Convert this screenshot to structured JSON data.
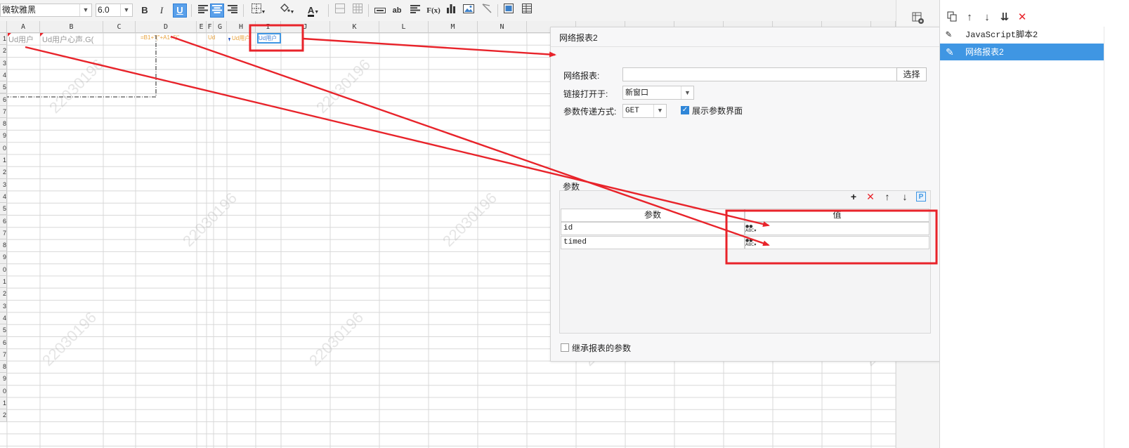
{
  "toolbar": {
    "font_name": "微软雅黑",
    "font_size": "6.0",
    "icons": [
      "bold-icon",
      "italic-icon",
      "underline-icon",
      "align-left-icon",
      "align-center-icon",
      "align-right-icon",
      "border-icon",
      "fill-color-icon",
      "font-color-icon",
      "merge-icon",
      "split-icon",
      "text-field-icon",
      "ab-icon",
      "paragraph-icon",
      "formula-icon",
      "bar-chart-icon",
      "image-icon",
      "slash-icon",
      "sheet-icon",
      "grid-icon"
    ],
    "bold": "B",
    "italic": "I",
    "underline": "U",
    "formula": "F(x)",
    "ab": "ab",
    "font_color_letter": "A"
  },
  "grid": {
    "columns": [
      "A",
      "B",
      "C",
      "D",
      "E",
      "F",
      "G",
      "H",
      "I",
      "J",
      "K",
      "L",
      "M",
      "N"
    ],
    "row_numbers": [
      "1",
      "2",
      "3",
      "4",
      "5",
      "6",
      "7",
      "8",
      "9",
      "0",
      "1",
      "2",
      "3",
      "4",
      "5",
      "6",
      "7",
      "8",
      "9",
      "0",
      "1",
      "2",
      "3",
      "4",
      "5",
      "6",
      "7",
      "8",
      "9",
      "0",
      "1",
      "2"
    ],
    "cells": {
      "a1": "Ud用户",
      "b1": "Ud用户心声.G(",
      "d1": "=B1+\"(\"+A1+\")\"",
      "h1": "Ud",
      "h1b": "Ud用户",
      "i1": "Ud用户"
    }
  },
  "watermark": "22030196",
  "dialog": {
    "title": "网络报表2",
    "report_label": "网络报表:",
    "report_value": "",
    "choose_button": "选择",
    "link_open_label": "链接打开于:",
    "link_open_value": "新窗口",
    "param_method_label": "参数传递方式:",
    "param_method_value": "GET",
    "show_params_label": "展示参数界面",
    "show_params_checked": true,
    "params_section_label": "参数",
    "params_table": {
      "headers": [
        "参数",
        "值"
      ],
      "rows": [
        {
          "name": "id",
          "value": ""
        },
        {
          "name": "timed",
          "value": ""
        }
      ]
    },
    "formula_icon_text": "ABC",
    "param_toolbar": {
      "add": "+",
      "delete": "✕",
      "up": "↑",
      "down": "↓",
      "p": "P"
    },
    "inherit_label": "继承报表的参数",
    "inherit_checked": false
  },
  "right_panel": {
    "toolbar": {
      "copy": "⎘",
      "up": "↑",
      "down": "↓",
      "sort": "⇊",
      "delete": "✕"
    },
    "items": [
      {
        "label": "JavaScript脚本2",
        "selected": false
      },
      {
        "label": "网络报表2",
        "selected": true
      }
    ]
  },
  "colors": {
    "accent": "#3f96e3",
    "annotation_red": "#e8232a",
    "formula_orange": "#e8a13a"
  }
}
